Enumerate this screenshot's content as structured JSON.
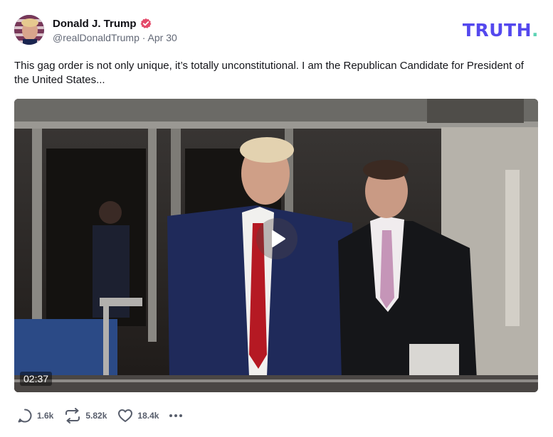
{
  "post": {
    "author_name": "Donald J. Trump",
    "handle": "@realDonaldTrump",
    "separator": "·",
    "date": "Apr 30",
    "text": "This gag order is not only unique, it’s totally unconstitutional. I am the Republican Candidate for President of the United States...",
    "verified_icon": "verified-badge-icon"
  },
  "brand": {
    "logo_text": "TRUTH",
    "logo_dot": ".",
    "accent_color": "#5448ee",
    "dot_color": "#5ed3b4"
  },
  "video": {
    "duration": "02:37",
    "play_icon": "play-icon"
  },
  "actions": {
    "replies": "1.6k",
    "retruths": "5.82k",
    "likes": "18.4k",
    "reply_icon": "comment-icon",
    "retruth_icon": "repost-icon",
    "like_icon": "heart-icon",
    "more_icon": "more-options-icon"
  }
}
